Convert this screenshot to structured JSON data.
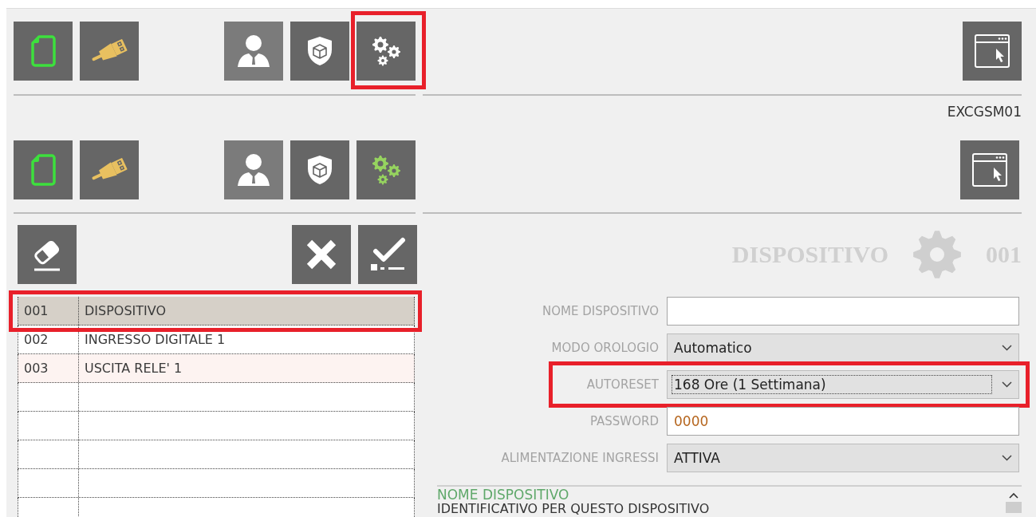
{
  "toolbar_top": {
    "left": [
      {
        "kind": "new-file",
        "selected": false,
        "highlighted": false
      },
      {
        "kind": "usb",
        "selected": false,
        "highlighted": false
      }
    ],
    "right": [
      {
        "kind": "user",
        "selected": false,
        "highlighted": false
      },
      {
        "kind": "security",
        "selected": false,
        "highlighted": false
      },
      {
        "kind": "settings",
        "selected": false,
        "highlighted": true
      }
    ],
    "panel_button": {
      "kind": "window"
    }
  },
  "device_code": "EXCGSM01",
  "toolbar_main": {
    "left": [
      {
        "kind": "new-file",
        "selected": false,
        "highlighted": false
      },
      {
        "kind": "usb",
        "selected": false,
        "highlighted": false
      }
    ],
    "right": [
      {
        "kind": "user",
        "selected": false,
        "highlighted": false
      },
      {
        "kind": "security",
        "selected": false,
        "highlighted": false
      },
      {
        "kind": "settings",
        "selected": true,
        "highlighted": false
      }
    ],
    "panel_button": {
      "kind": "window"
    }
  },
  "list_toolbar": {
    "left": [
      {
        "kind": "erase"
      }
    ],
    "right": [
      {
        "kind": "cancel"
      },
      {
        "kind": "confirm"
      }
    ]
  },
  "items": [
    {
      "code": "001",
      "name": "DISPOSITIVO",
      "selected": true,
      "hovered": false,
      "highlighted": true
    },
    {
      "code": "002",
      "name": "INGRESSO DIGITALE 1",
      "selected": false,
      "hovered": false,
      "highlighted": false
    },
    {
      "code": "003",
      "name": "USCITA RELE' 1",
      "selected": false,
      "hovered": true,
      "highlighted": false
    }
  ],
  "detail": {
    "title": "DISPOSITIVO",
    "number": "001",
    "fields": [
      {
        "label": "NOME DISPOSITIVO",
        "kind": "text",
        "focused": false,
        "highlighted": false
      },
      {
        "label": "MODO OROLOGIO",
        "kind": "select",
        "value": "Automatico",
        "focused": false,
        "highlighted": false
      },
      {
        "label": "AUTORESET",
        "kind": "select",
        "value": "168 Ore (1 Settimana)",
        "focused": true,
        "highlighted": true
      },
      {
        "label": "PASSWORD",
        "kind": "password",
        "value": "0000",
        "focused": false,
        "highlighted": false
      },
      {
        "label": "ALIMENTAZIONE INGRESSI",
        "kind": "select",
        "value": "ATTIVA",
        "focused": false,
        "highlighted": false
      }
    ]
  },
  "help": {
    "title": "NOME DISPOSITIVO",
    "text": "IDENTIFICATIVO PER QUESTO DISPOSITIVO"
  }
}
